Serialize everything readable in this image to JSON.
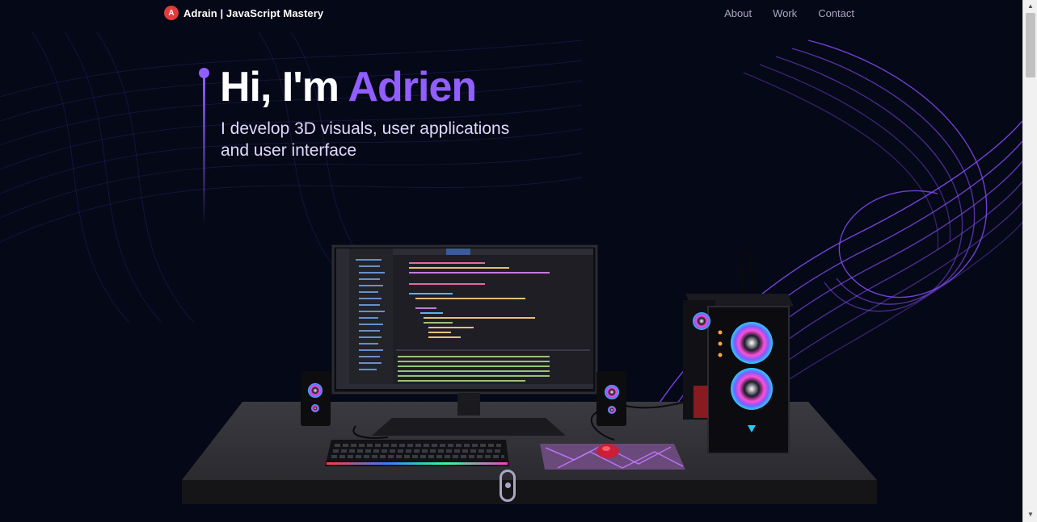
{
  "navbar": {
    "logo_letter": "A",
    "brand": "Adrain | JavaScript Mastery",
    "links": [
      {
        "label": "About"
      },
      {
        "label": "Work"
      },
      {
        "label": "Contact"
      }
    ]
  },
  "hero": {
    "greeting": "Hi, I'm ",
    "name": "Adrien",
    "subtitle": "I develop 3D visuals, user applications and user interface"
  },
  "colors": {
    "background": "#050816",
    "accent": "#915eff",
    "secondary_text": "#aaa6c3"
  },
  "scene": {
    "objects": [
      "desk",
      "monitor",
      "code-editor",
      "speakers",
      "keyboard",
      "mousepad",
      "mouse",
      "pc-tower"
    ]
  },
  "scrollbar": {
    "up_arrow": "▲",
    "down_arrow": "▼"
  }
}
